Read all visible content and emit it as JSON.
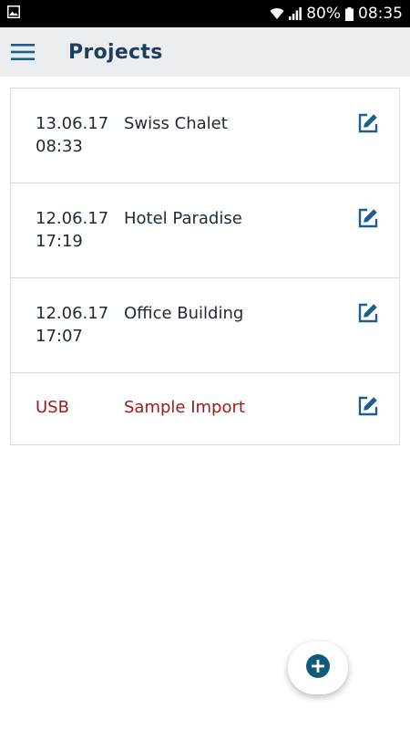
{
  "status_bar": {
    "battery": "80%",
    "time": "08:35",
    "icons": [
      "gallery-icon",
      "wifi-icon",
      "signal-icon",
      "battery-icon"
    ]
  },
  "app_bar": {
    "menu_icon": "hamburger-menu-icon",
    "title": "Projects"
  },
  "projects": [
    {
      "date": "13.06.17",
      "time": "08:33",
      "name": "Swiss Chalet",
      "icon": "edit-icon"
    },
    {
      "date": "12.06.17",
      "time": "17:19",
      "name": "Hotel Paradise",
      "icon": "edit-icon"
    },
    {
      "date": "12.06.17",
      "time": "17:07",
      "name": "Office Building",
      "icon": "edit-icon"
    }
  ],
  "usb_import": {
    "source": "USB",
    "name": "Sample Import",
    "icon": "edit-icon"
  },
  "fab": {
    "icon": "add-circle-icon"
  },
  "colors": {
    "primary": "#1f5d8a",
    "title": "#1f3d5c",
    "usb_text": "#9b1a1a",
    "app_bar_bg": "#ebeef1",
    "fab_icon": "#0f5a7a"
  }
}
